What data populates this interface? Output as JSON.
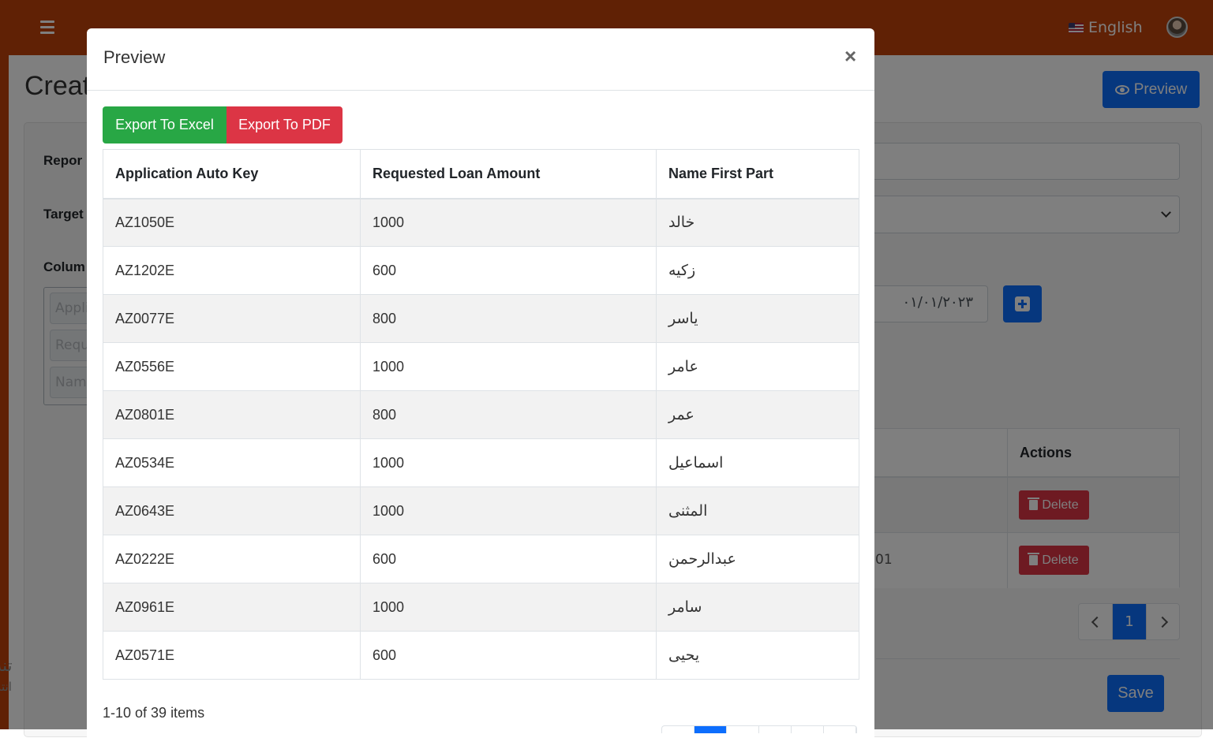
{
  "topbar": {
    "language": "English"
  },
  "page": {
    "title_partial": "Creat",
    "preview_button": "Preview",
    "labels": {
      "report": "Repor",
      "target": "Target",
      "columns": "Colum"
    },
    "date_value": "٠١/٠١/٢٠٢٣",
    "column_chips": [
      "Appli",
      "Requ",
      "Nam"
    ],
    "table": {
      "actions_header": "Actions",
      "partial_cell": "01",
      "delete_label": "Delete"
    },
    "pagination": {
      "current": "1"
    },
    "save_button": "Save",
    "footer": {
      "line1": "تنة",
      "line2": "انتة"
    }
  },
  "modal": {
    "title": "Preview",
    "close": "×",
    "export_excel": "Export To Excel",
    "export_pdf": "Export To PDF",
    "columns": [
      "Application Auto Key",
      "Requested Loan Amount",
      "Name First Part"
    ],
    "rows": [
      [
        "AZ1050E",
        "1000",
        "خالد"
      ],
      [
        "AZ1202E",
        "600",
        "زكيه"
      ],
      [
        "AZ0077E",
        "800",
        "ياسر"
      ],
      [
        "AZ0556E",
        "1000",
        "عامر"
      ],
      [
        "AZ0801E",
        "800",
        "عمر"
      ],
      [
        "AZ0534E",
        "1000",
        "اسماعيل"
      ],
      [
        "AZ0643E",
        "1000",
        "المثنى"
      ],
      [
        "AZ0222E",
        "600",
        "عبدالرحمن"
      ],
      [
        "AZ0961E",
        "1000",
        "سامر"
      ],
      [
        "AZ0571E",
        "600",
        "يحيى"
      ]
    ],
    "items_count": "1-10 of 39 items"
  }
}
